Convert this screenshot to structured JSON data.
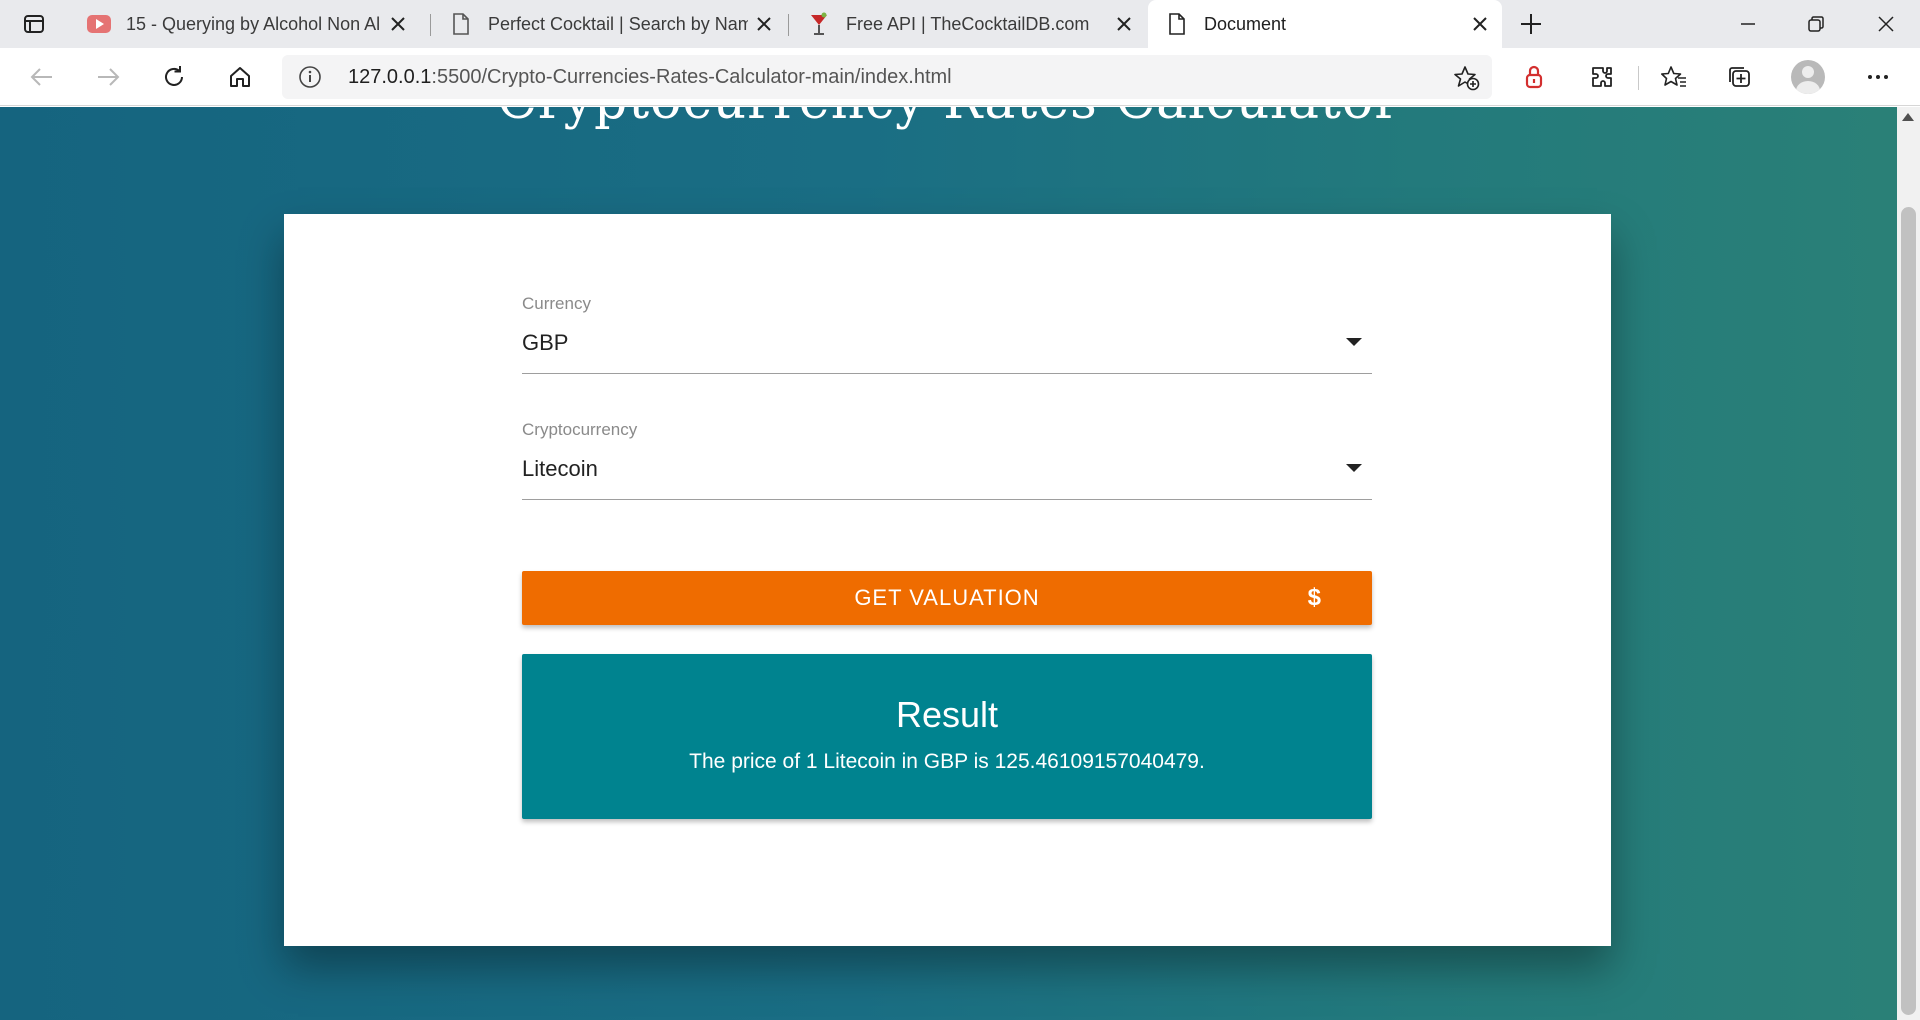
{
  "browser": {
    "tabs": [
      {
        "title": "15 - Querying by Alcohol Non Al",
        "icon": "youtube-icon",
        "active": false
      },
      {
        "title": "Perfect Cocktail | Search by Nam",
        "icon": "page-icon",
        "active": false
      },
      {
        "title": "Free API | TheCocktailDB.com",
        "icon": "cocktail-icon",
        "active": false
      },
      {
        "title": "Document",
        "icon": "page-icon",
        "active": true
      }
    ],
    "url_host": "127.0.0.1",
    "url_path": ":5500/Crypto-Currencies-Rates-Calculator-main/index.html"
  },
  "page": {
    "title": "Cryptocurrency Rates Calculator",
    "currency": {
      "label": "Currency",
      "value": "GBP"
    },
    "cryptocurrency": {
      "label": "Cryptocurrency",
      "value": "Litecoin"
    },
    "button": {
      "label": "GET VALUATION",
      "icon": "$"
    },
    "result": {
      "title": "Result",
      "text": "The price of 1 Litecoin in GBP is 125.46109157040479."
    }
  },
  "colors": {
    "button": "#ef6c00",
    "result_bg": "#00838f",
    "page_bg_start": "#15647f",
    "page_bg_end": "#2a8077"
  }
}
